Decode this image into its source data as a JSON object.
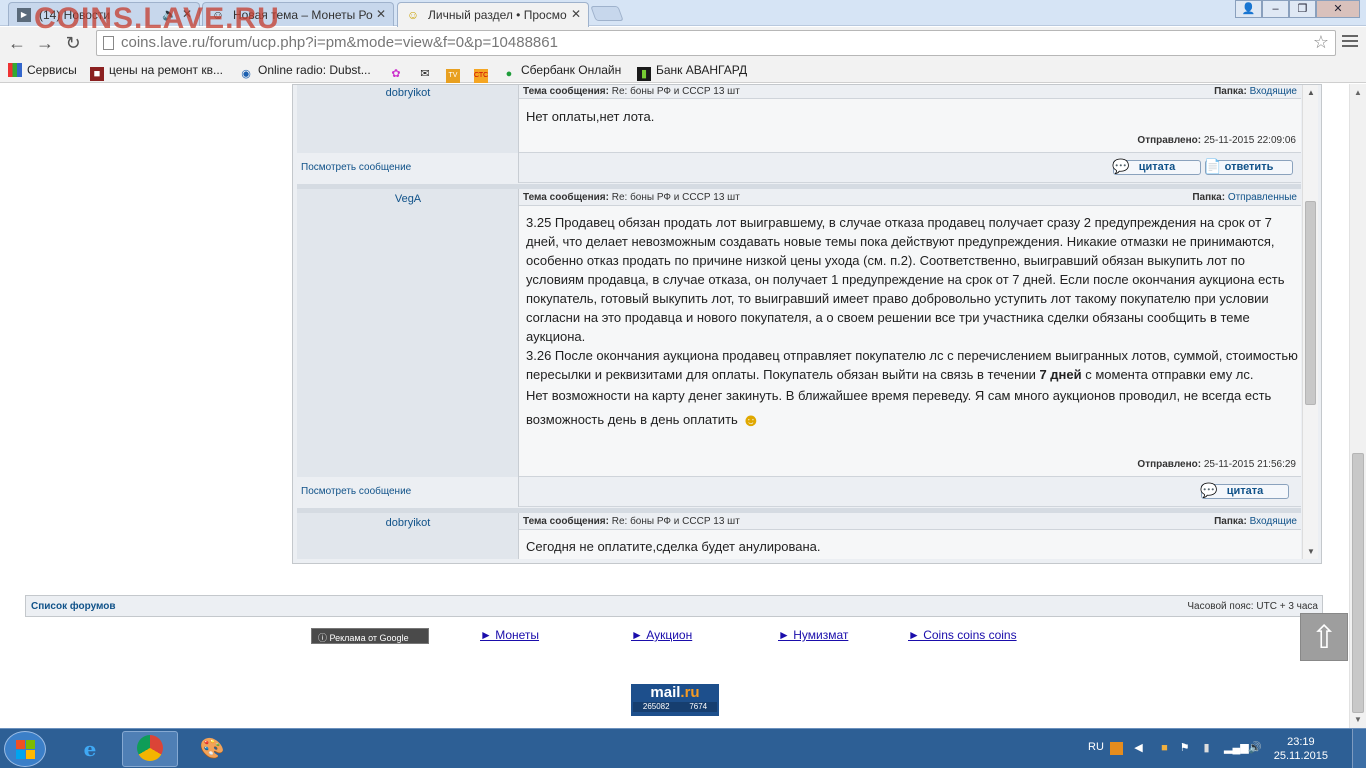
{
  "watermark": "COINS.LAVE.RU",
  "tabs": [
    {
      "title": "(14) Новости",
      "active": false
    },
    {
      "title": "Новая тема – Монеты Ро",
      "active": false
    },
    {
      "title": "Личный раздел • Просмо",
      "active": true
    }
  ],
  "address": "coins.lave.ru/forum/ucp.php?i=pm&mode=view&f=0&p=10488861",
  "bookmarks": [
    {
      "label": "Сервисы",
      "icon": "apps-icon"
    },
    {
      "label": "цены на ремонт кв...",
      "icon": "site-icon"
    },
    {
      "label": "Online radio: Dubst...",
      "icon": "radio-icon"
    },
    {
      "label": "",
      "icon": "colors-icon"
    },
    {
      "label": "",
      "icon": "mail-icon"
    },
    {
      "label": "",
      "icon": "tv-icon"
    },
    {
      "label": "",
      "icon": "ctc-icon"
    },
    {
      "label": "Сбербанк Онлайн",
      "icon": "sberbank-icon"
    },
    {
      "label": "Банк АВАНГАРД",
      "icon": "avangard-icon"
    }
  ],
  "labels": {
    "subject": "Тема сообщения:",
    "folder": "Папка:",
    "sent": "Отправлено:",
    "view_message": "Посмотреть сообщение",
    "quote": "цитата",
    "reply": "ответить"
  },
  "posts": [
    {
      "author": "dobryikot",
      "subject": "Re: боны РФ и СССР 13 шт",
      "folder": "Входящие",
      "text": "Нет оплаты,нет лота.",
      "sent": "25-11-2015 22:09:06"
    },
    {
      "author": "VegA",
      "subject": "Re: боны РФ и СССР 13 шт",
      "folder": "Отправленные",
      "paragraphs": [
        "3.25 Продавец обязан продать лот выигравшему, в случае отказа продавец получает сразу 2 предупреждения на срок от 7 дней, что делает невозможным создавать новые темы пока действуют предупреждения. Никакие отмазки не принимаются, особенно отказ продать по причине низкой цены ухода (см. п.2). Соответственно, выигравший обязан выкупить лот по условиям продавца, в случае отказа, он получает 1 предупреждение на срок от 7 дней. Если после окончания аукциона есть покупатель, готовый выкупить лот, то выигравший имеет право добровольно уступить лот такому покупателю при условии согласни на это продавца и нового покупателя, а о своем решении все три участника сделки обязаны сообщить в теме аукциона."
      ],
      "p2_before": "3.26 После окончания аукциона продавец отправляет покупателю лс с перечислением выигранных лотов, суммой, стоимостью пересылки и реквизитами для оплаты. Покупатель обязан выйти на связь в течении ",
      "p2_bold": "7 дней",
      "p2_after": " с момента отправки ему лс.",
      "p3": "Нет возможности на карту денег закинуть. В ближайшее время переведу. Я сам много аукционов проводил, не всегда есть возможность день в день оплатить",
      "sent": "25-11-2015 21:56:29"
    },
    {
      "author": "dobryikot",
      "subject": "Re: боны РФ и СССР 13 шт",
      "folder": "Входящие",
      "text": "Сегодня не оплатите,сделка будет анулирована."
    }
  ],
  "navbar": {
    "left": "Список форумов",
    "right": "Часовой пояс: UTC + 3 часа"
  },
  "ads": {
    "label": "Реклама от Google",
    "links": [
      "► Монеты",
      "► Аукцион",
      "► Нумизмат",
      "► Coins coins coins"
    ]
  },
  "mailru": {
    "logo_a": "mail",
    "logo_b": ".ru",
    "count_a": "265082",
    "count_b": "7674"
  },
  "tray": {
    "lang": "RU",
    "time": "23:19",
    "date": "25.11.2015"
  }
}
